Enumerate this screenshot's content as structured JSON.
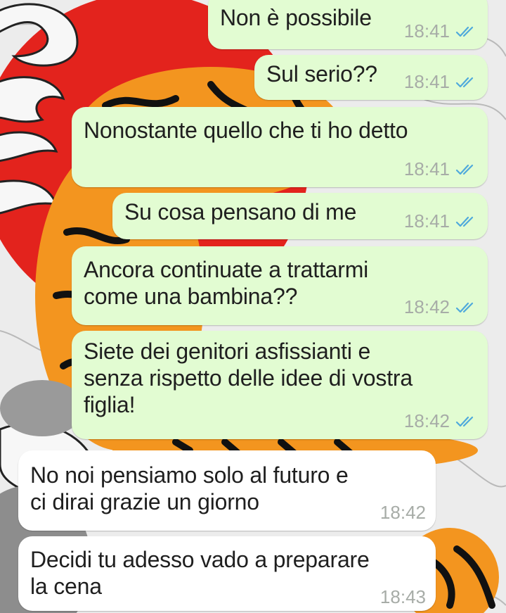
{
  "colors": {
    "outgoing_bubble": "#e2fcd2",
    "incoming_bubble": "#ffffff",
    "read_tick": "#4fa9dc",
    "timestamp": "#a7aca7",
    "wallpaper_red": "#e3231d",
    "wallpaper_orange": "#f3951f"
  },
  "messages": [
    {
      "direction": "outgoing",
      "text": "Non è possibile",
      "time": "18:41",
      "status": "read-double-tick-icon"
    },
    {
      "direction": "outgoing",
      "text": "Sul serio??",
      "time": "18:41",
      "status": "read-double-tick-icon"
    },
    {
      "direction": "outgoing",
      "text": "Nonostante quello che ti ho detto",
      "time": "18:41",
      "status": "read-double-tick-icon"
    },
    {
      "direction": "outgoing",
      "text": "Su cosa pensano di me",
      "time": "18:41",
      "status": "read-double-tick-icon"
    },
    {
      "direction": "outgoing",
      "text": "Ancora continuate a trattarmi\ncome una bambina??",
      "time": "18:42",
      "status": "read-double-tick-icon"
    },
    {
      "direction": "outgoing",
      "text": "Siete dei genitori asfissianti e\nsenza rispetto delle idee di vostra\nfiglia!",
      "time": "18:42",
      "status": "read-double-tick-icon"
    },
    {
      "direction": "incoming",
      "text": "No noi pensiamo solo al futuro e\nci dirai grazie un giorno",
      "time": "18:42"
    },
    {
      "direction": "incoming",
      "text": "Decidi tu adesso vado a preparare\nla cena",
      "time": "18:43"
    }
  ]
}
